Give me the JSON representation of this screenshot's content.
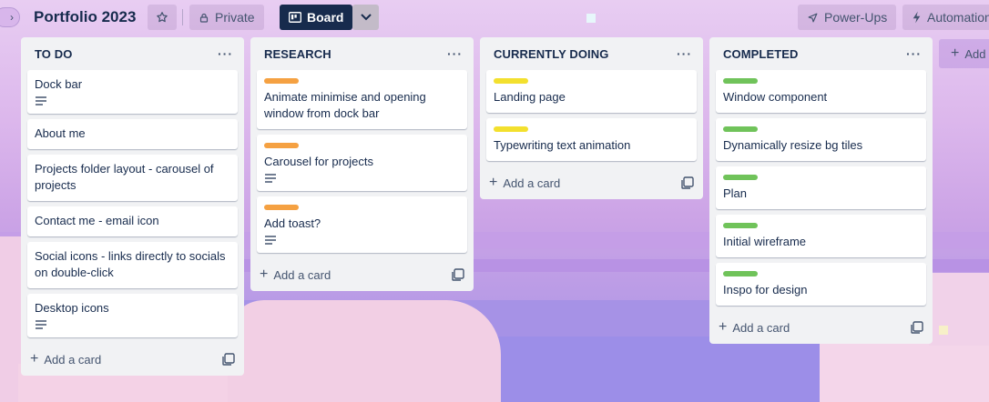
{
  "board": {
    "title": "Portfolio 2023",
    "visibility_label": "Private",
    "view_label": "Board",
    "powerups_label": "Power-Ups",
    "automation_label": "Automation",
    "add_list_label": "Add"
  },
  "lists": [
    {
      "title": "TO DO",
      "menu": "···",
      "add_card_label": "Add a card",
      "cards": [
        {
          "title": "Dock bar",
          "label": null,
          "has_description": true
        },
        {
          "title": "About me",
          "label": null,
          "has_description": false
        },
        {
          "title": "Projects folder layout - carousel of projects",
          "label": null,
          "has_description": false
        },
        {
          "title": "Contact me - email icon",
          "label": null,
          "has_description": false
        },
        {
          "title": "Social icons - links directly to socials on double-click",
          "label": null,
          "has_description": false
        },
        {
          "title": "Desktop icons",
          "label": null,
          "has_description": true
        }
      ]
    },
    {
      "title": "RESEARCH",
      "menu": "···",
      "add_card_label": "Add a card",
      "cards": [
        {
          "title": "Animate minimise and opening window from dock bar",
          "label": "orange",
          "has_description": false
        },
        {
          "title": "Carousel for projects",
          "label": "orange",
          "has_description": true
        },
        {
          "title": "Add toast?",
          "label": "orange",
          "has_description": true
        }
      ]
    },
    {
      "title": "CURRENTLY DOING",
      "menu": "···",
      "add_card_label": "Add a card",
      "cards": [
        {
          "title": "Landing page",
          "label": "yellow",
          "has_description": false
        },
        {
          "title": "Typewriting text animation",
          "label": "yellow",
          "has_description": false
        }
      ]
    },
    {
      "title": "COMPLETED",
      "menu": "···",
      "add_card_label": "Add a card",
      "cards": [
        {
          "title": "Window component",
          "label": "green",
          "has_description": false
        },
        {
          "title": "Dynamically resize bg tiles",
          "label": "green",
          "has_description": false
        },
        {
          "title": "Plan",
          "label": "green",
          "has_description": false
        },
        {
          "title": "Initial wireframe",
          "label": "green",
          "has_description": false
        },
        {
          "title": "Inspo for design",
          "label": "green",
          "has_description": false
        }
      ]
    }
  ],
  "colors": {
    "label_orange": "#f5a142",
    "label_yellow": "#f3e02e",
    "label_green": "#70c35a",
    "board_button": "#172b4d",
    "list_bg": "#f1f2f4"
  },
  "icons": [
    "chevron-right-icon",
    "star-icon",
    "lock-icon",
    "board-icon",
    "chevron-down-icon",
    "rocket-icon",
    "bolt-icon",
    "description-icon",
    "plus-icon",
    "template-icon"
  ]
}
